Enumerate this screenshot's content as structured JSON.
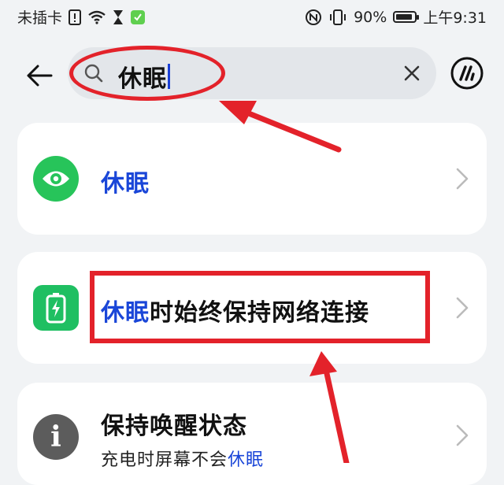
{
  "status_bar": {
    "carrier": "未插卡",
    "battery_percent": "90%",
    "battery_level": 0.9,
    "time": "上午9:31",
    "icons": [
      "sim-alert-icon",
      "wifi-icon",
      "hourglass-icon",
      "battery-saver-icon",
      "nfc-icon",
      "vibrate-icon",
      "battery-icon"
    ]
  },
  "search": {
    "value": "休眠",
    "icons": [
      "back-arrow-icon",
      "search-icon",
      "clear-icon",
      "assistant-icon"
    ]
  },
  "results": [
    {
      "highlight": "休眠",
      "rest": "",
      "icon": "eye-icon",
      "icon_color": "#27c45a"
    },
    {
      "highlight": "休眠",
      "rest": "时始终保持网络连接",
      "icon": "battery-charge-icon",
      "icon_color": "#1fbf62"
    },
    {
      "title": "保持唤醒状态",
      "subtitle_prefix": "充电时屏幕不会",
      "subtitle_highlight": "休眠",
      "icon": "info-icon",
      "icon_glyph": "i",
      "icon_color": "#5c5c5c"
    }
  ],
  "colors": {
    "highlight_text": "#1a46d8",
    "annotation_red": "#e3222a",
    "background": "#f1f3f5"
  }
}
